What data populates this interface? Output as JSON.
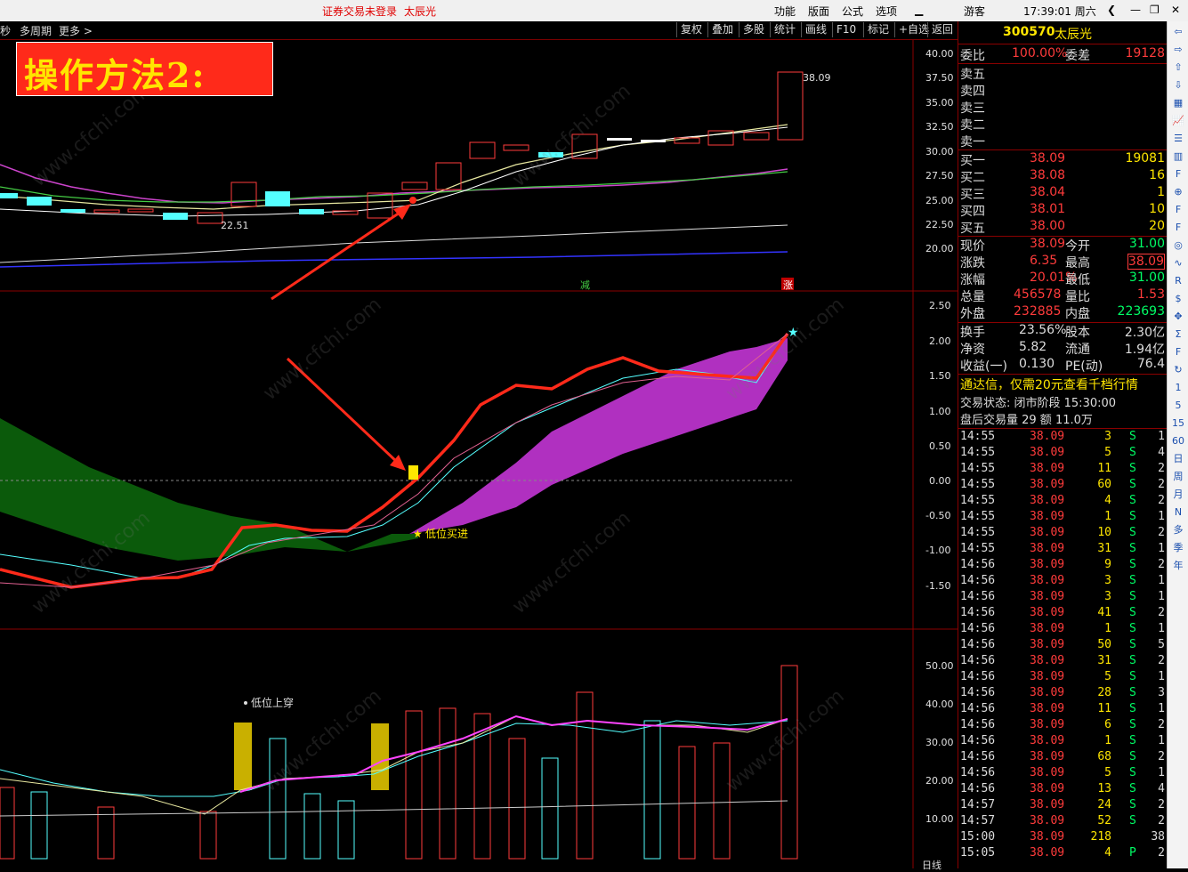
{
  "titlebar": {
    "status": "证券交易未登录",
    "stock_name": "太辰光",
    "menus": [
      "功能",
      "版面",
      "公式",
      "选项"
    ],
    "user": "游客",
    "clock": "17:39:01 周六"
  },
  "toolbar": {
    "left_items": [
      "秒",
      "多周期",
      "更多 >"
    ],
    "buttons": [
      "复权",
      "叠加",
      "多股",
      "统计",
      "画线",
      "F10",
      "标记",
      "+自选",
      "返回"
    ]
  },
  "banner": {
    "text": "操作方法2:"
  },
  "main_chart": {
    "price_label_high": "38.09",
    "price_label_low": "22.51",
    "y_ticks": [
      "40.00",
      "37.50",
      "35.00",
      "32.50",
      "30.00",
      "27.50",
      "25.00",
      "22.50",
      "20.00"
    ],
    "markers": [
      "减",
      "涨"
    ]
  },
  "indicator1": {
    "y_ticks": [
      "2.50",
      "2.00",
      "1.50",
      "1.00",
      "0.50",
      "0.00",
      "-0.50",
      "-1.00",
      "-1.50"
    ],
    "buy_label": "低位买进"
  },
  "indicator2": {
    "y_ticks": [
      "50.00",
      "40.00",
      "30.00",
      "20.00",
      "10.00"
    ],
    "cross_label": "低位上穿",
    "bottom_tab": "日线"
  },
  "quote": {
    "code": "300570",
    "name": "太辰光",
    "ratio_label": "委比",
    "ratio_value": "100.00%",
    "diff_label": "委差",
    "diff_value": "19128",
    "sells": [
      {
        "label": "卖五"
      },
      {
        "label": "卖四"
      },
      {
        "label": "卖三"
      },
      {
        "label": "卖二"
      },
      {
        "label": "卖一"
      }
    ],
    "buys": [
      {
        "label": "买一",
        "price": "38.09",
        "vol": "19081"
      },
      {
        "label": "买二",
        "price": "38.08",
        "vol": "16"
      },
      {
        "label": "买三",
        "price": "38.04",
        "vol": "1"
      },
      {
        "label": "买四",
        "price": "38.01",
        "vol": "10"
      },
      {
        "label": "买五",
        "price": "38.00",
        "vol": "20"
      }
    ],
    "stats": [
      {
        "l1": "现价",
        "v1": "38.09",
        "l2": "今开",
        "v2": "31.00"
      },
      {
        "l1": "涨跌",
        "v1": "6.35",
        "l2": "最高",
        "v2": "38.09"
      },
      {
        "l1": "涨幅",
        "v1": "20.01%",
        "l2": "最低",
        "v2": "31.00"
      },
      {
        "l1": "总量",
        "v1": "456578",
        "l2": "量比",
        "v2": "1.53"
      },
      {
        "l1": "外盘",
        "v1": "232885",
        "l2": "内盘",
        "v2": "223693"
      }
    ],
    "stats2": [
      {
        "l1": "换手",
        "v1": "23.56%",
        "l2": "股本",
        "v2": "2.30亿"
      },
      {
        "l1": "净资",
        "v1": "5.82",
        "l2": "流通",
        "v2": "1.94亿"
      },
      {
        "l1": "收益(一)",
        "v1": "0.130",
        "l2": "PE(动)",
        "v2": "76.4"
      }
    ],
    "notice": "通达信，仅需20元查看千档行情",
    "trade_status": "交易状态: 闭市阶段 15:30:00",
    "after_trade": "盘后交易量 29 额 11.0万"
  },
  "ticks": [
    {
      "t": "14:55",
      "p": "38.09",
      "v": "3",
      "s": "S",
      "n": "1"
    },
    {
      "t": "14:55",
      "p": "38.09",
      "v": "5",
      "s": "S",
      "n": "4"
    },
    {
      "t": "14:55",
      "p": "38.09",
      "v": "11",
      "s": "S",
      "n": "2"
    },
    {
      "t": "14:55",
      "p": "38.09",
      "v": "60",
      "s": "S",
      "n": "2"
    },
    {
      "t": "14:55",
      "p": "38.09",
      "v": "4",
      "s": "S",
      "n": "2"
    },
    {
      "t": "14:55",
      "p": "38.09",
      "v": "1",
      "s": "S",
      "n": "1"
    },
    {
      "t": "14:55",
      "p": "38.09",
      "v": "10",
      "s": "S",
      "n": "2"
    },
    {
      "t": "14:55",
      "p": "38.09",
      "v": "31",
      "s": "S",
      "n": "1"
    },
    {
      "t": "14:56",
      "p": "38.09",
      "v": "9",
      "s": "S",
      "n": "2"
    },
    {
      "t": "14:56",
      "p": "38.09",
      "v": "3",
      "s": "S",
      "n": "1"
    },
    {
      "t": "14:56",
      "p": "38.09",
      "v": "3",
      "s": "S",
      "n": "1"
    },
    {
      "t": "14:56",
      "p": "38.09",
      "v": "41",
      "s": "S",
      "n": "2"
    },
    {
      "t": "14:56",
      "p": "38.09",
      "v": "1",
      "s": "S",
      "n": "1"
    },
    {
      "t": "14:56",
      "p": "38.09",
      "v": "50",
      "s": "S",
      "n": "5"
    },
    {
      "t": "14:56",
      "p": "38.09",
      "v": "31",
      "s": "S",
      "n": "2"
    },
    {
      "t": "14:56",
      "p": "38.09",
      "v": "5",
      "s": "S",
      "n": "1"
    },
    {
      "t": "14:56",
      "p": "38.09",
      "v": "28",
      "s": "S",
      "n": "3"
    },
    {
      "t": "14:56",
      "p": "38.09",
      "v": "11",
      "s": "S",
      "n": "1"
    },
    {
      "t": "14:56",
      "p": "38.09",
      "v": "6",
      "s": "S",
      "n": "2"
    },
    {
      "t": "14:56",
      "p": "38.09",
      "v": "1",
      "s": "S",
      "n": "1"
    },
    {
      "t": "14:56",
      "p": "38.09",
      "v": "68",
      "s": "S",
      "n": "2"
    },
    {
      "t": "14:56",
      "p": "38.09",
      "v": "5",
      "s": "S",
      "n": "1"
    },
    {
      "t": "14:56",
      "p": "38.09",
      "v": "13",
      "s": "S",
      "n": "4"
    },
    {
      "t": "14:57",
      "p": "38.09",
      "v": "24",
      "s": "S",
      "n": "2"
    },
    {
      "t": "14:57",
      "p": "38.09",
      "v": "52",
      "s": "S",
      "n": "2"
    },
    {
      "t": "15:00",
      "p": "38.09",
      "v": "218",
      "s": "",
      "n": "38"
    },
    {
      "t": "15:05",
      "p": "38.09",
      "v": "4",
      "s": "P",
      "n": "2"
    }
  ],
  "sidebar_icons": [
    "back-icon",
    "forward-icon",
    "up-icon",
    "down-icon",
    "grid-icon",
    "chart-icon",
    "list-icon",
    "bars-icon",
    "f10-icon",
    "zoom-icon",
    "f12-icon",
    "f11-icon",
    "circle-icon",
    "wave-icon",
    "rsi-icon",
    "money-icon",
    "move-icon",
    "sum-icon",
    "f5-icon",
    "refresh-icon",
    "1",
    "5",
    "15",
    "60",
    "日",
    "周",
    "月",
    "N",
    "多",
    "季",
    "年"
  ],
  "colors": {
    "up": "#ff3b3b",
    "down": "#54ffff",
    "accent": "#ffe600",
    "ma_yellow": "#e8e8a0",
    "magenta": "#c040d0"
  }
}
